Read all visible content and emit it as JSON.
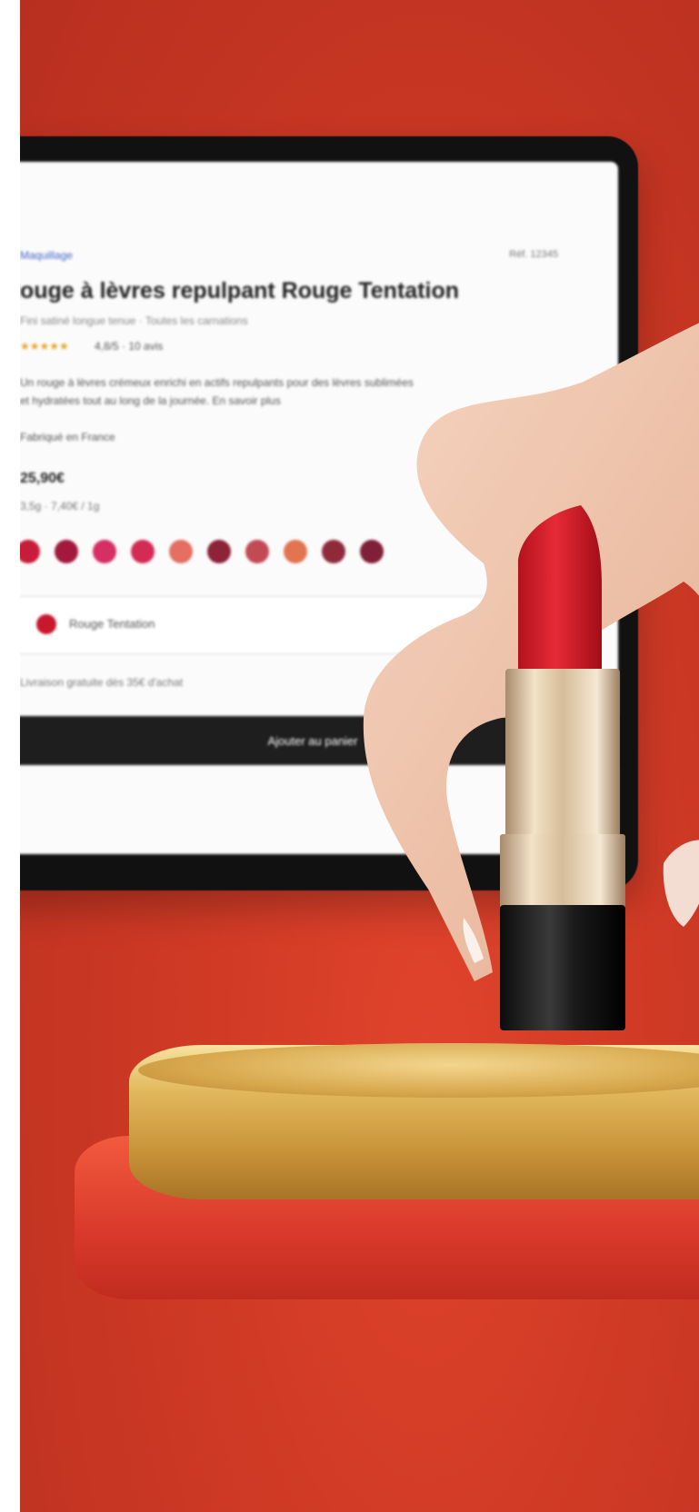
{
  "screen": {
    "breadcrumb": "Maquillage",
    "reference": "Réf. 12345",
    "product_title": "Rouge à lèvres repulpant Rouge Tentation",
    "subtitle": "Fini satiné longue tenue · Toutes les carnations",
    "stars": "★★★★★",
    "reviews": "4,8/5 · 10 avis",
    "description_line1": "Un rouge à lèvres crémeux enrichi en actifs repulpants pour des lèvres sublimées",
    "description_line2": "et hydratées tout au long de la journée. En savoir plus",
    "origin": "Fabriqué en France",
    "price": "25,90€",
    "unit_price": "3,5g · 7,40€ / 1g",
    "swatch_colors": [
      "#c81d3a",
      "#a3193e",
      "#d52f66",
      "#d42b55",
      "#e46e62",
      "#8d2238",
      "#c24a55",
      "#e27451",
      "#8f2a3b",
      "#7f1f38"
    ],
    "selected_shade": "Rouge Tentation",
    "note": "Livraison gratuite dès 35€ d'achat",
    "cta_label": "Ajouter au panier"
  }
}
